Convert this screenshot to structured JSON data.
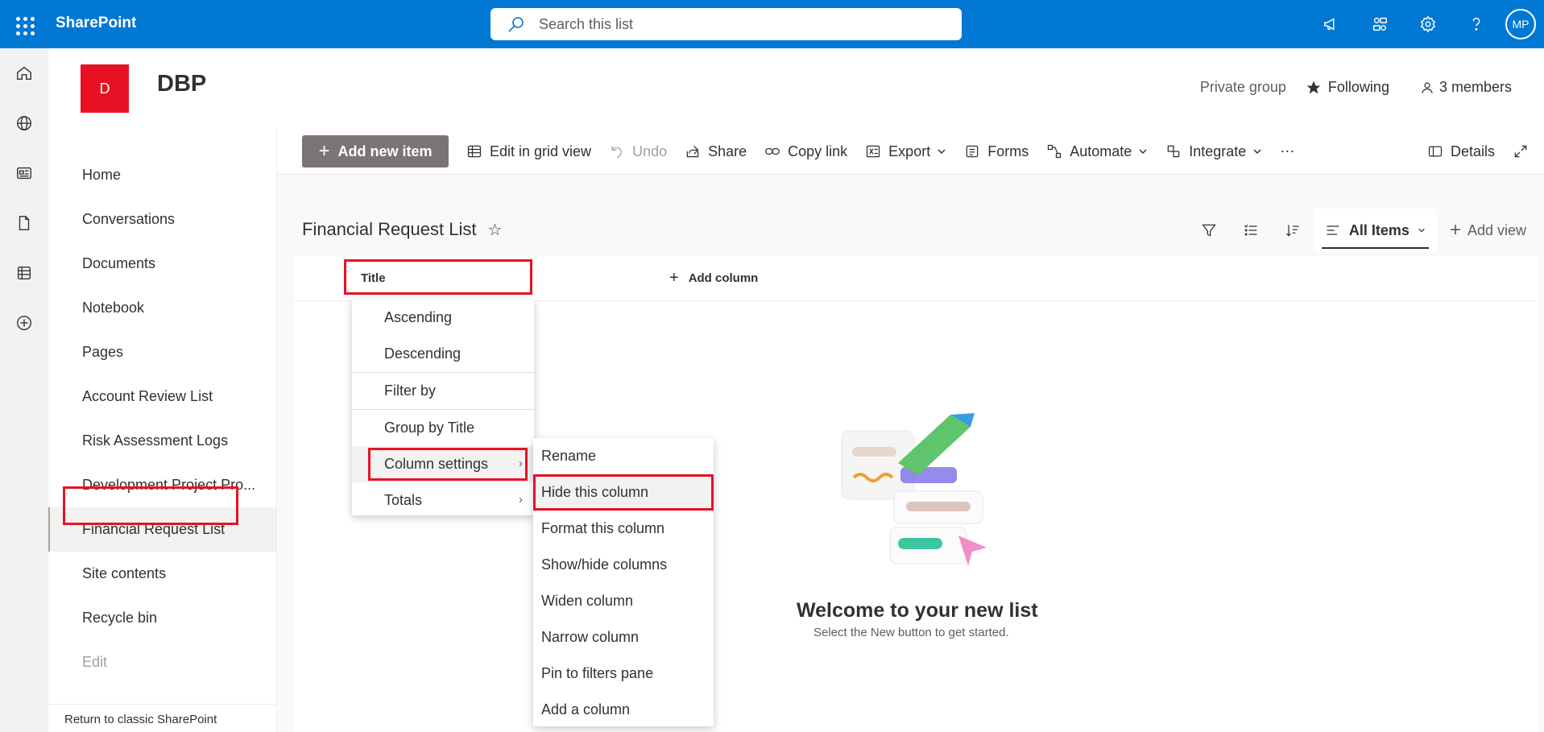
{
  "suitebar": {
    "brand": "SharePoint",
    "search_placeholder": "Search this list",
    "avatar_initials": "MP",
    "bg_color": "#0078d4"
  },
  "site": {
    "logo_letter": "D",
    "title": "DBP",
    "privacy": "Private group",
    "following_label": "Following",
    "members_label": "3 members"
  },
  "nav": {
    "items": [
      "Home",
      "Conversations",
      "Documents",
      "Notebook",
      "Pages",
      "Account Review List",
      "Risk Assessment Logs",
      "Development Project Pro...",
      "Financial Request List",
      "Site contents",
      "Recycle bin"
    ],
    "edit_label": "Edit",
    "selected": "Financial Request List",
    "return_classic": "Return to classic SharePoint"
  },
  "commandbar": {
    "add_new_item": "Add new item",
    "edit_grid": "Edit in grid view",
    "undo": "Undo",
    "share": "Share",
    "copy_link": "Copy link",
    "export": "Export",
    "forms": "Forms",
    "automate": "Automate",
    "integrate": "Integrate",
    "more": "⋯",
    "details": "Details"
  },
  "list": {
    "title": "Financial Request List",
    "view_name": "All Items",
    "add_view": "Add view",
    "column_title": "Title",
    "add_column": "Add column",
    "welcome_title": "Welcome to your new list",
    "welcome_subtitle": "Select the New button to get started."
  },
  "context_menu": {
    "items": [
      "Ascending",
      "Descending",
      "Filter by",
      "Group by Title",
      "Column settings",
      "Totals"
    ]
  },
  "submenu": {
    "items": [
      "Rename",
      "Hide this column",
      "Format this column",
      "Show/hide columns",
      "Widen column",
      "Narrow column",
      "Pin to filters pane",
      "Add a column"
    ]
  },
  "highlight_color": "#e81123"
}
